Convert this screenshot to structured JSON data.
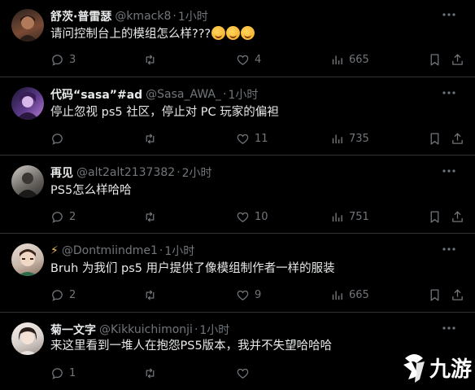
{
  "tweets": [
    {
      "name": "舒茨·普雷瑟",
      "handle": "@kmack8",
      "time": "1小时",
      "text": "请问控制台上的模组怎么样???",
      "emoji_count": 3,
      "replies": "3",
      "retweets": "",
      "likes": "4",
      "views": "665",
      "avatar_color": "#5a3b2a"
    },
    {
      "name": "代码“sasa”#ad",
      "handle": "@Sasa_AWA_",
      "time": "1小时",
      "text": "停止忽视 ps5 社区，停止对 PC 玩家的偏袒",
      "replies": "",
      "retweets": "",
      "likes": "11",
      "views": "735",
      "avatar_color": "#4b2e6e"
    },
    {
      "name": "再见",
      "handle": "@alt2alt2137382",
      "time": "2小时",
      "text": "PS5怎么样哈哈",
      "replies": "2",
      "retweets": "",
      "likes": "10",
      "views": "751",
      "avatar_color": "#6e6a66"
    },
    {
      "name": "⚡",
      "handle": "@Dontmiindme1",
      "time": "1小时",
      "text": "Bruh 为我们 ps5 用户提供了像模组制作者一样的服装",
      "replies": "2",
      "retweets": "",
      "likes": "9",
      "views": "665",
      "avatar_color": "#c9b9ad"
    },
    {
      "name": "菊一文字",
      "handle": "@Kikkuichimonji",
      "time": "1小时",
      "text": "来这里看到一堆人在抱怨PS5版本，我并不失望哈哈哈",
      "replies": "1",
      "retweets": "",
      "likes": "",
      "views": "",
      "avatar_color": "#d9d1cc"
    }
  ],
  "watermark": {
    "text": "九游"
  },
  "colors": {
    "background": "#000000",
    "text": "#e7e9ea",
    "muted": "#71767b",
    "divider": "#2f3336"
  }
}
